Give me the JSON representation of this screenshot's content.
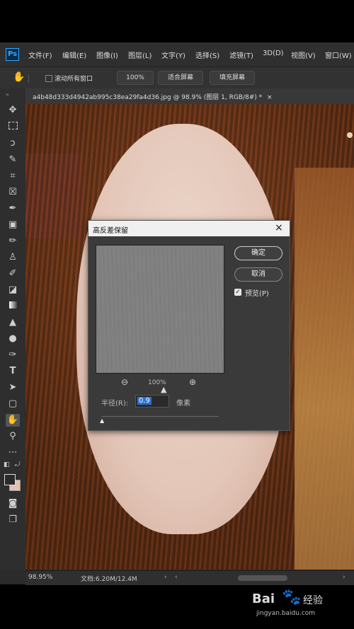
{
  "app": {
    "logo": "Ps",
    "accent": "#31a8ff"
  },
  "menu": [
    "文件(F)",
    "编辑(E)",
    "图像(I)",
    "图层(L)",
    "文字(Y)",
    "选择(S)",
    "滤镜(T)",
    "3D(D)",
    "视图(V)",
    "窗口(W)"
  ],
  "options": {
    "scroll_all": "滚动所有窗口",
    "zoom_100": "100%",
    "fit_screen": "适合屏幕",
    "fill_screen": "填充屏幕"
  },
  "document_tab": {
    "title": "a4b48d333d4942ab995c38ea29fa4d36.jpg @ 98.9% (图层 1, RGB/8#) *",
    "close": "×"
  },
  "dialog": {
    "title": "高反差保留",
    "close": "×",
    "ok": "确定",
    "cancel": "取消",
    "preview_label": "预览(P)",
    "preview_checked": true,
    "zoom": "100%",
    "radius_label": "半径(R):",
    "radius_value": "0.9",
    "unit": "像素"
  },
  "status": {
    "zoom": "98.95%",
    "doc_size": "文档:6.20M/12.4M"
  },
  "watermark": {
    "brand": "Bai",
    "brand2": "经验",
    "url": "jingyan.baidu.com"
  }
}
